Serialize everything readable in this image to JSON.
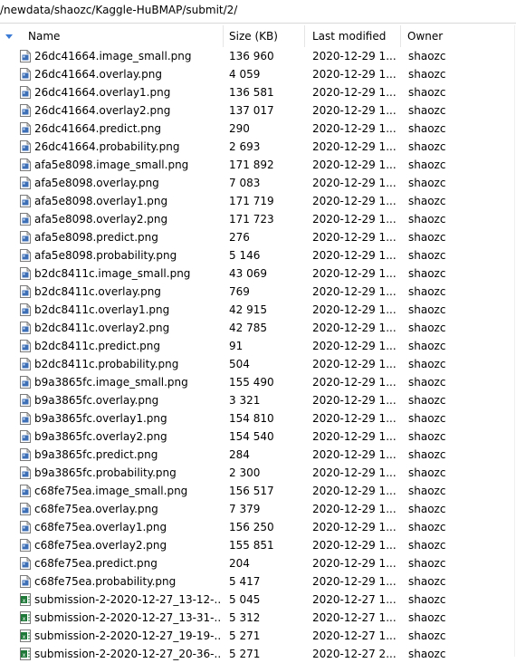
{
  "path": "/newdata/shaozc/Kaggle-HuBMAP/submit/2/",
  "columns": {
    "name": "Name",
    "size": "Size (KB)",
    "modified": "Last modified",
    "owner": "Owner"
  },
  "colors": {
    "png_icon": "#3d6fb6",
    "csv_icon": "#1f7a3a",
    "sort_arrow": "#3b7bd6"
  },
  "files": [
    {
      "name": "26dc41664.image_small.png",
      "size": "136 960",
      "modified": "2020-12-29 1...",
      "owner": "shaozc",
      "icon": "png-file-icon"
    },
    {
      "name": "26dc41664.overlay.png",
      "size": "4 059",
      "modified": "2020-12-29 1...",
      "owner": "shaozc",
      "icon": "png-file-icon"
    },
    {
      "name": "26dc41664.overlay1.png",
      "size": "136 581",
      "modified": "2020-12-29 1...",
      "owner": "shaozc",
      "icon": "png-file-icon"
    },
    {
      "name": "26dc41664.overlay2.png",
      "size": "137 017",
      "modified": "2020-12-29 1...",
      "owner": "shaozc",
      "icon": "png-file-icon"
    },
    {
      "name": "26dc41664.predict.png",
      "size": "290",
      "modified": "2020-12-29 1...",
      "owner": "shaozc",
      "icon": "png-file-icon"
    },
    {
      "name": "26dc41664.probability.png",
      "size": "2 693",
      "modified": "2020-12-29 1...",
      "owner": "shaozc",
      "icon": "png-file-icon"
    },
    {
      "name": "afa5e8098.image_small.png",
      "size": "171 892",
      "modified": "2020-12-29 1...",
      "owner": "shaozc",
      "icon": "png-file-icon"
    },
    {
      "name": "afa5e8098.overlay.png",
      "size": "7 083",
      "modified": "2020-12-29 1...",
      "owner": "shaozc",
      "icon": "png-file-icon"
    },
    {
      "name": "afa5e8098.overlay1.png",
      "size": "171 719",
      "modified": "2020-12-29 1...",
      "owner": "shaozc",
      "icon": "png-file-icon"
    },
    {
      "name": "afa5e8098.overlay2.png",
      "size": "171 723",
      "modified": "2020-12-29 1...",
      "owner": "shaozc",
      "icon": "png-file-icon"
    },
    {
      "name": "afa5e8098.predict.png",
      "size": "276",
      "modified": "2020-12-29 1...",
      "owner": "shaozc",
      "icon": "png-file-icon"
    },
    {
      "name": "afa5e8098.probability.png",
      "size": "5 146",
      "modified": "2020-12-29 1...",
      "owner": "shaozc",
      "icon": "png-file-icon"
    },
    {
      "name": "b2dc8411c.image_small.png",
      "size": "43 069",
      "modified": "2020-12-29 1...",
      "owner": "shaozc",
      "icon": "png-file-icon"
    },
    {
      "name": "b2dc8411c.overlay.png",
      "size": "769",
      "modified": "2020-12-29 1...",
      "owner": "shaozc",
      "icon": "png-file-icon"
    },
    {
      "name": "b2dc8411c.overlay1.png",
      "size": "42 915",
      "modified": "2020-12-29 1...",
      "owner": "shaozc",
      "icon": "png-file-icon"
    },
    {
      "name": "b2dc8411c.overlay2.png",
      "size": "42 785",
      "modified": "2020-12-29 1...",
      "owner": "shaozc",
      "icon": "png-file-icon"
    },
    {
      "name": "b2dc8411c.predict.png",
      "size": "91",
      "modified": "2020-12-29 1...",
      "owner": "shaozc",
      "icon": "png-file-icon"
    },
    {
      "name": "b2dc8411c.probability.png",
      "size": "504",
      "modified": "2020-12-29 1...",
      "owner": "shaozc",
      "icon": "png-file-icon"
    },
    {
      "name": "b9a3865fc.image_small.png",
      "size": "155 490",
      "modified": "2020-12-29 1...",
      "owner": "shaozc",
      "icon": "png-file-icon"
    },
    {
      "name": "b9a3865fc.overlay.png",
      "size": "3 321",
      "modified": "2020-12-29 1...",
      "owner": "shaozc",
      "icon": "png-file-icon"
    },
    {
      "name": "b9a3865fc.overlay1.png",
      "size": "154 810",
      "modified": "2020-12-29 1...",
      "owner": "shaozc",
      "icon": "png-file-icon"
    },
    {
      "name": "b9a3865fc.overlay2.png",
      "size": "154 540",
      "modified": "2020-12-29 1...",
      "owner": "shaozc",
      "icon": "png-file-icon"
    },
    {
      "name": "b9a3865fc.predict.png",
      "size": "284",
      "modified": "2020-12-29 1...",
      "owner": "shaozc",
      "icon": "png-file-icon"
    },
    {
      "name": "b9a3865fc.probability.png",
      "size": "2 300",
      "modified": "2020-12-29 1...",
      "owner": "shaozc",
      "icon": "png-file-icon"
    },
    {
      "name": "c68fe75ea.image_small.png",
      "size": "156 517",
      "modified": "2020-12-29 1...",
      "owner": "shaozc",
      "icon": "png-file-icon"
    },
    {
      "name": "c68fe75ea.overlay.png",
      "size": "7 379",
      "modified": "2020-12-29 1...",
      "owner": "shaozc",
      "icon": "png-file-icon"
    },
    {
      "name": "c68fe75ea.overlay1.png",
      "size": "156 250",
      "modified": "2020-12-29 1...",
      "owner": "shaozc",
      "icon": "png-file-icon"
    },
    {
      "name": "c68fe75ea.overlay2.png",
      "size": "155 851",
      "modified": "2020-12-29 1...",
      "owner": "shaozc",
      "icon": "png-file-icon"
    },
    {
      "name": "c68fe75ea.predict.png",
      "size": "204",
      "modified": "2020-12-29 1...",
      "owner": "shaozc",
      "icon": "png-file-icon"
    },
    {
      "name": "c68fe75ea.probability.png",
      "size": "5 417",
      "modified": "2020-12-29 1...",
      "owner": "shaozc",
      "icon": "png-file-icon"
    },
    {
      "name": "submission-2-2020-12-27_13-12-...",
      "size": "5 045",
      "modified": "2020-12-27 1...",
      "owner": "shaozc",
      "icon": "csv-file-icon"
    },
    {
      "name": "submission-2-2020-12-27_13-31-...",
      "size": "5 312",
      "modified": "2020-12-27 1...",
      "owner": "shaozc",
      "icon": "csv-file-icon"
    },
    {
      "name": "submission-2-2020-12-27_19-19-...",
      "size": "5 271",
      "modified": "2020-12-27 1...",
      "owner": "shaozc",
      "icon": "csv-file-icon"
    },
    {
      "name": "submission-2-2020-12-27_20-36-...",
      "size": "5 271",
      "modified": "2020-12-27 2...",
      "owner": "shaozc",
      "icon": "csv-file-icon"
    }
  ]
}
